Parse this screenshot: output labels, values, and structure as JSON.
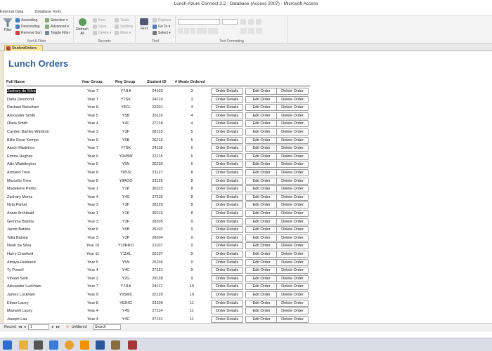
{
  "window": {
    "title": "Lunch-Azure Connect 2.2 : Database (Access 2007)  -  Microsoft Access"
  },
  "ribbon_tabs": [
    "External Data",
    "Database Tools"
  ],
  "ribbon": {
    "sort_filter": {
      "filter": "Filter",
      "ascending": "Ascending",
      "descending": "Descending",
      "remove_sort": "Remove Sort",
      "selection": "Selection",
      "advanced": "Advanced",
      "toggle_filter": "Toggle Filter",
      "label": "Sort & Filter"
    },
    "records": {
      "refresh": "Refresh All",
      "new": "New",
      "save": "Save",
      "delete": "Delete",
      "totals": "Totals",
      "spelling": "Spelling",
      "more": "More",
      "label": "Records"
    },
    "find": {
      "find": "Find",
      "replace": "Replace",
      "goto": "Go To",
      "select": "Select",
      "label": "Find"
    },
    "text_formatting": {
      "label": "Text Formatting"
    }
  },
  "doc_tab": {
    "label": "StudentOrders"
  },
  "form": {
    "title": "Lunch Orders",
    "headers": {
      "name": "Full Name",
      "year": "Year Group",
      "reg": "Reg Group",
      "sid": "Student ID",
      "meals": "# Meals Ordered"
    },
    "buttons": {
      "order_details": "Order Details",
      "edit_order": "Edit Order",
      "delete_order": "Delete Order"
    },
    "rows": [
      {
        "name": "Zackary da Silva",
        "year": "Year 7",
        "reg": "Y7JHI",
        "sid": "24103",
        "meals": "3"
      },
      {
        "name": "Daria Desmond",
        "year": "Year 7",
        "reg": "Y7SK",
        "sid": "24210",
        "meals": "3"
      },
      {
        "name": "Rachael Betschart",
        "year": "Year 8",
        "reg": "Y8CL",
        "sid": "23201",
        "meals": "4"
      },
      {
        "name": "Alexander Smith",
        "year": "Year 5",
        "reg": "Y5B",
        "sid": "26119",
        "meals": "4"
      },
      {
        "name": "Olivia Smith",
        "year": "Year 4",
        "reg": "Y4C",
        "sid": "27218",
        "meals": "4"
      },
      {
        "name": "Cayden Bartley-Waldron",
        "year": "Year 3",
        "reg": "Y3F",
        "sid": "28125",
        "meals": "5"
      },
      {
        "name": "Billie Rose Kempe",
        "year": "Year 5",
        "reg": "Y5B",
        "sid": "26216",
        "meals": "5"
      },
      {
        "name": "Aaron Madeiros",
        "year": "Year 7",
        "reg": "Y7SK",
        "sid": "24118",
        "meals": "6"
      },
      {
        "name": "Emma Hughes",
        "year": "Year 9",
        "reg": "Y9VBW",
        "sid": "22215",
        "meals": "6"
      },
      {
        "name": "Ailie Waddington",
        "year": "Year 5",
        "reg": "Y5N",
        "sid": "26230",
        "meals": "6"
      },
      {
        "name": "Armand Trew",
        "year": "Year 8",
        "reg": "Y8SSI",
        "sid": "23127",
        "meals": "8"
      },
      {
        "name": "Marcello Trew",
        "year": "Year 8",
        "reg": "Y8AOO",
        "sid": "23126",
        "meals": "8"
      },
      {
        "name": "Madeleine Pedro",
        "year": "Year 1",
        "reg": "Y1P",
        "sid": "30223",
        "meals": "8"
      },
      {
        "name": "Zachary Moniz",
        "year": "Year 4",
        "reg": "Y4S",
        "sid": "27118",
        "meals": "8"
      },
      {
        "name": "Nyla Parker",
        "year": "Year 3",
        "reg": "Y3F",
        "sid": "28220",
        "meals": "8"
      },
      {
        "name": "Annie Archibald",
        "year": "Year 1",
        "reg": "Y1K",
        "sid": "30216",
        "meals": "8"
      },
      {
        "name": "Gemma Batista",
        "year": "Year 3",
        "reg": "Y3F",
        "sid": "28205",
        "meals": "9"
      },
      {
        "name": "Jacob Batista",
        "year": "Year 6",
        "reg": "Y6B",
        "sid": "25102",
        "meals": "9"
      },
      {
        "name": "Talia Batista",
        "year": "Year 3",
        "reg": "Y3P",
        "sid": "28204",
        "meals": "9"
      },
      {
        "name": "Noah da Silva",
        "year": "Year 10",
        "reg": "Y10RRO",
        "sid": "21107",
        "meals": "9"
      },
      {
        "name": "Harry Crawford",
        "year": "Year 11",
        "reg": "Y11KL",
        "sid": "20107",
        "meals": "9"
      },
      {
        "name": "Amaya Husband",
        "year": "Year 5",
        "reg": "Y5N",
        "sid": "26236",
        "meals": "9"
      },
      {
        "name": "Ty Powell",
        "year": "Year 4",
        "reg": "Y4C",
        "sid": "27121",
        "meals": "9"
      },
      {
        "name": "Vihaan Seth",
        "year": "Year 2",
        "reg": "Y2G",
        "sid": "29128",
        "meals": "9"
      },
      {
        "name": "Alexander Luckham",
        "year": "Year 7",
        "reg": "Y7JHI",
        "sid": "24117",
        "meals": "10"
      },
      {
        "name": "James Luckham",
        "year": "Year 9",
        "reg": "Y9SMC",
        "sid": "22120",
        "meals": "10"
      },
      {
        "name": "Ethan Lacey",
        "year": "Year 8",
        "reg": "Y8JHG",
        "sid": "23109",
        "meals": "11"
      },
      {
        "name": "Maxwell Lacey",
        "year": "Year 4",
        "reg": "Y4S",
        "sid": "27114",
        "meals": "11"
      },
      {
        "name": "Joseph Lau",
        "year": "Year 4",
        "reg": "Y4C",
        "sid": "27131",
        "meals": "11"
      }
    ]
  },
  "record_nav": {
    "label": "Record:",
    "first": "◂◂",
    "prev": "◂",
    "position": "1",
    "next": "▸",
    "last": "▸▸",
    "filter_status": "Unfiltered",
    "search": "Search"
  },
  "colors": {
    "title": "#2b5f9e",
    "doc_tab": "#fce9a8"
  }
}
